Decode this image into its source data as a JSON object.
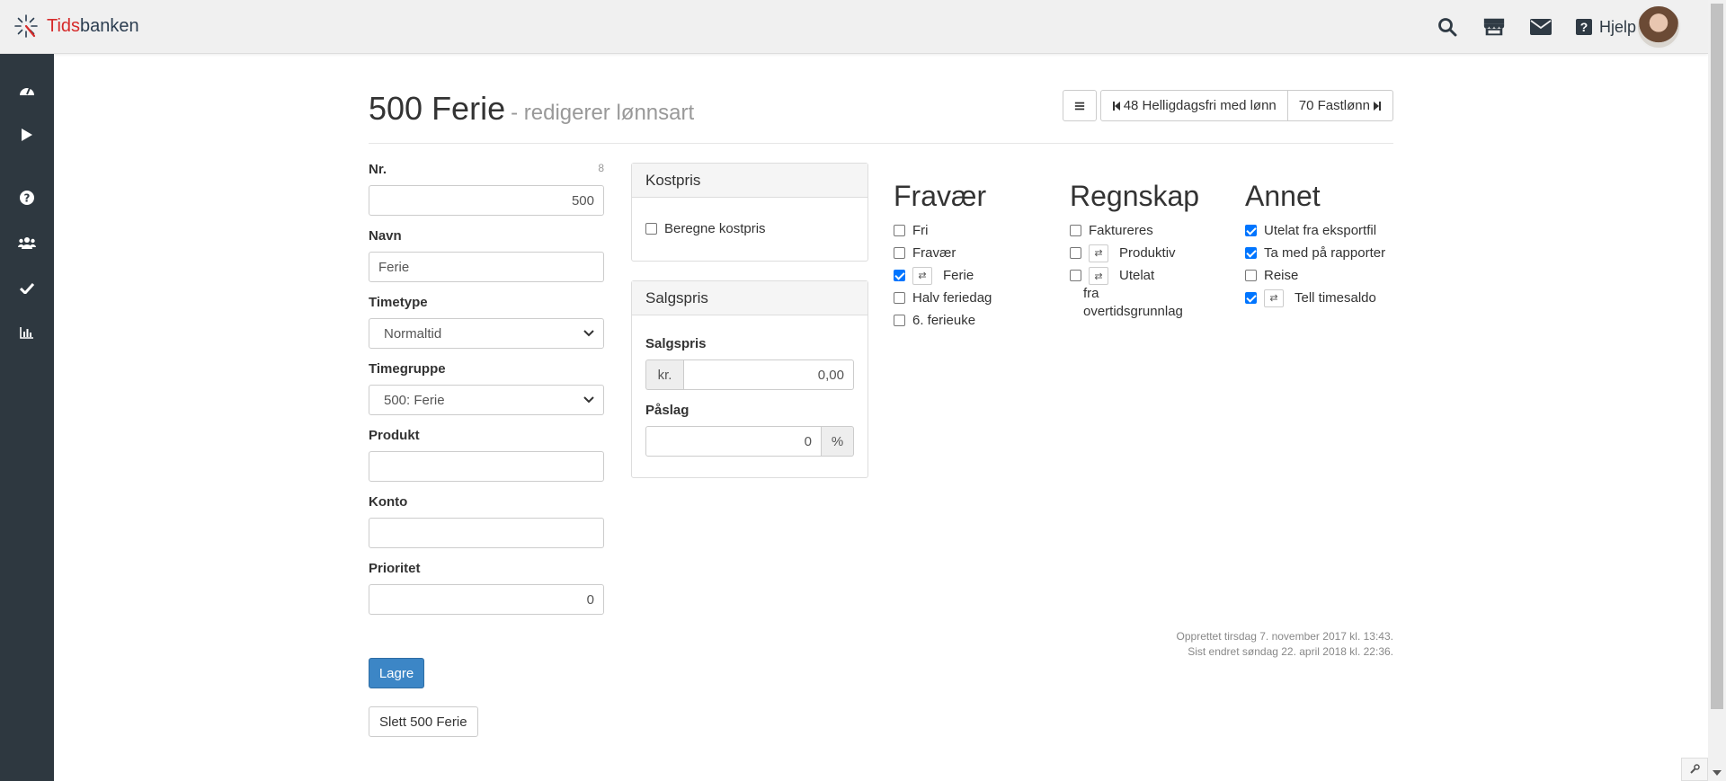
{
  "brand": {
    "text_red": "Tids",
    "text_dark": "banken"
  },
  "topbar": {
    "help_label": "Hjelp"
  },
  "header": {
    "title": "500 Ferie",
    "subtitle": "- redigerer lønnsart"
  },
  "nav": {
    "prev_label": "48 Helligdagsfri med lønn",
    "next_label": "70 Fastlønn"
  },
  "form": {
    "nr": {
      "label": "Nr.",
      "counter": "8",
      "value": "500"
    },
    "navn": {
      "label": "Navn",
      "value": "Ferie"
    },
    "timetype": {
      "label": "Timetype",
      "value": "Normaltid"
    },
    "timegruppe": {
      "label": "Timegruppe",
      "value": "500: Ferie"
    },
    "produkt": {
      "label": "Produkt",
      "value": ""
    },
    "konto": {
      "label": "Konto",
      "value": ""
    },
    "prioritet": {
      "label": "Prioritet",
      "value": "0"
    },
    "save_label": "Lagre",
    "delete_label": "Slett 500 Ferie"
  },
  "kostpris": {
    "title": "Kostpris",
    "checkbox_label": "Beregne kostpris"
  },
  "salgspris": {
    "title": "Salgspris",
    "price_label": "Salgspris",
    "currency": "kr.",
    "price_value": "0,00",
    "markup_label": "Påslag",
    "markup_value": "0",
    "markup_unit": "%"
  },
  "fravaer": {
    "title": "Fravær",
    "items": [
      "Fri",
      "Fravær",
      "Ferie",
      "Halv feriedag",
      "6. ferieuke"
    ]
  },
  "regnskap": {
    "title": "Regnskap",
    "items": [
      "Faktureres",
      "Produktiv",
      "Utelat fra overtidsgrunnlag"
    ]
  },
  "annet": {
    "title": "Annet",
    "items": [
      "Utelat fra eksportfil",
      "Ta med på rapporter",
      "Reise",
      "Tell timesaldo"
    ]
  },
  "meta": {
    "created": "Opprettet tirsdag 7. november 2017 kl. 13:43.",
    "modified": "Sist endret søndag 22. april 2018 kl. 22:36."
  },
  "colors": {
    "sidebar": "#2e3840",
    "primary": "#3c86c6",
    "check": "#0075ff",
    "brand_red": "#d62b2b"
  }
}
